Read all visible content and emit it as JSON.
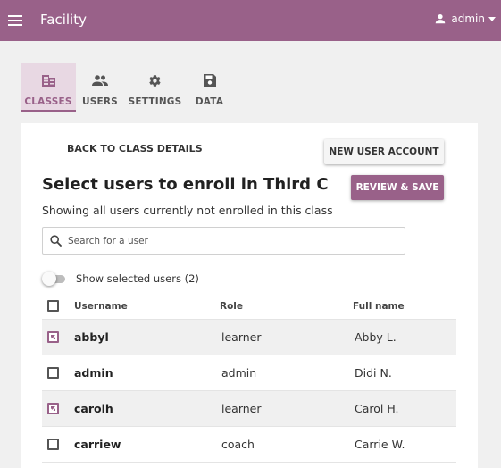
{
  "appbar": {
    "title": "Facility",
    "user_name": "admin",
    "color": "#996189"
  },
  "tabs": [
    {
      "label": "CLASSES",
      "icon": "building-icon",
      "active": true
    },
    {
      "label": "USERS",
      "icon": "people-icon",
      "active": false
    },
    {
      "label": "SETTINGS",
      "icon": "gear-icon",
      "active": false
    },
    {
      "label": "DATA",
      "icon": "save-icon",
      "active": false
    }
  ],
  "page": {
    "back_link": "BACK TO CLASS DETAILS",
    "new_user_button": "NEW USER ACCOUNT",
    "review_button": "REVIEW & SAVE",
    "heading": "Select users to enroll in Third C",
    "subtitle": "Showing all users currently not enrolled in this class",
    "search_placeholder": "Search for a user",
    "toggle_label": "Show selected users (2)",
    "toggle_on": false
  },
  "table": {
    "headers": {
      "username": "Username",
      "role": "Role",
      "full_name": "Full name"
    },
    "rows": [
      {
        "username": "abbyl",
        "role": "learner",
        "full_name": "Abby L.",
        "selected": true
      },
      {
        "username": "admin",
        "role": "admin",
        "full_name": "Didi N.",
        "selected": false
      },
      {
        "username": "carolh",
        "role": "learner",
        "full_name": "Carol H.",
        "selected": true
      },
      {
        "username": "carriew",
        "role": "coach",
        "full_name": "Carrie W.",
        "selected": false
      }
    ]
  }
}
